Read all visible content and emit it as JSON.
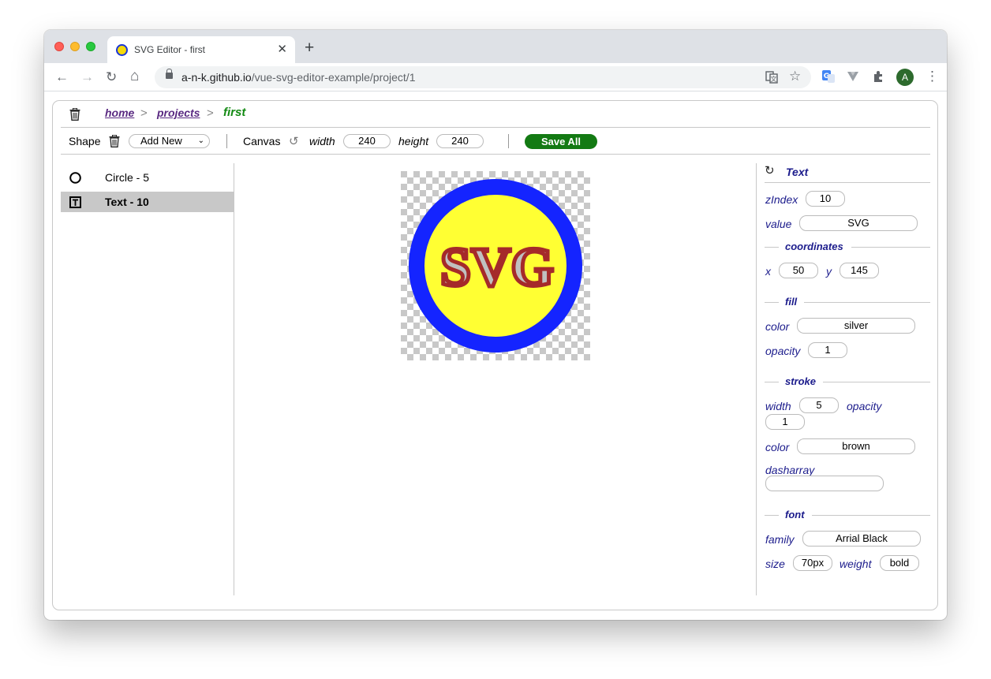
{
  "browser": {
    "tab_title": "SVG Editor - first",
    "tab_close": "✕",
    "new_tab": "+",
    "url_host": "a-n-k.github.io",
    "url_path": "/vue-svg-editor-example/project/1",
    "avatar_letter": "A",
    "back_glyph": "←",
    "forward_glyph": "→",
    "reload_glyph": "↻",
    "home_glyph": "⌂",
    "menu_glyph": "⋮"
  },
  "breadcrumb": {
    "home": "home",
    "projects": "projects",
    "separator": ">",
    "current": "first"
  },
  "shapebar": {
    "shape_label": "Shape",
    "add_new": "Add New",
    "canvas_label": "Canvas",
    "width_label": "width",
    "width_value": "240",
    "height_label": "height",
    "height_value": "240",
    "save_all": "Save All"
  },
  "shapes": [
    {
      "label": "Circle - 5",
      "type": "circle",
      "selected": false
    },
    {
      "label": "Text - 10",
      "type": "text",
      "selected": true
    }
  ],
  "canvas": {
    "width": 240,
    "height": 240,
    "circle": {
      "fill": "#ffff33",
      "stroke": "#1424ff"
    },
    "text": {
      "value": "SVG",
      "fill": "silver",
      "stroke": "brown"
    }
  },
  "props": {
    "title": "Text",
    "zindex_label": "zIndex",
    "zindex": "10",
    "value_label": "value",
    "value": "SVG",
    "coordinates_title": "coordinates",
    "x_label": "x",
    "x": "50",
    "y_label": "y",
    "y": "145",
    "fill_title": "fill",
    "fill_color_label": "color",
    "fill_color": "silver",
    "fill_opacity_label": "opacity",
    "fill_opacity": "1",
    "stroke_title": "stroke",
    "stroke_width_label": "width",
    "stroke_width": "5",
    "stroke_opacity_label": "opacity",
    "stroke_opacity": "1",
    "stroke_color_label": "color",
    "stroke_color": "brown",
    "dasharray_label": "dasharray",
    "dasharray": "",
    "font_title": "font",
    "family_label": "family",
    "family": "Arrial Black",
    "size_label": "size",
    "size": "70px",
    "weight_label": "weight",
    "weight": "bold"
  },
  "colors": {
    "link": "#5a2a82",
    "current": "#138a13",
    "save": "#137a13",
    "panel_text": "#1c1c8c"
  }
}
